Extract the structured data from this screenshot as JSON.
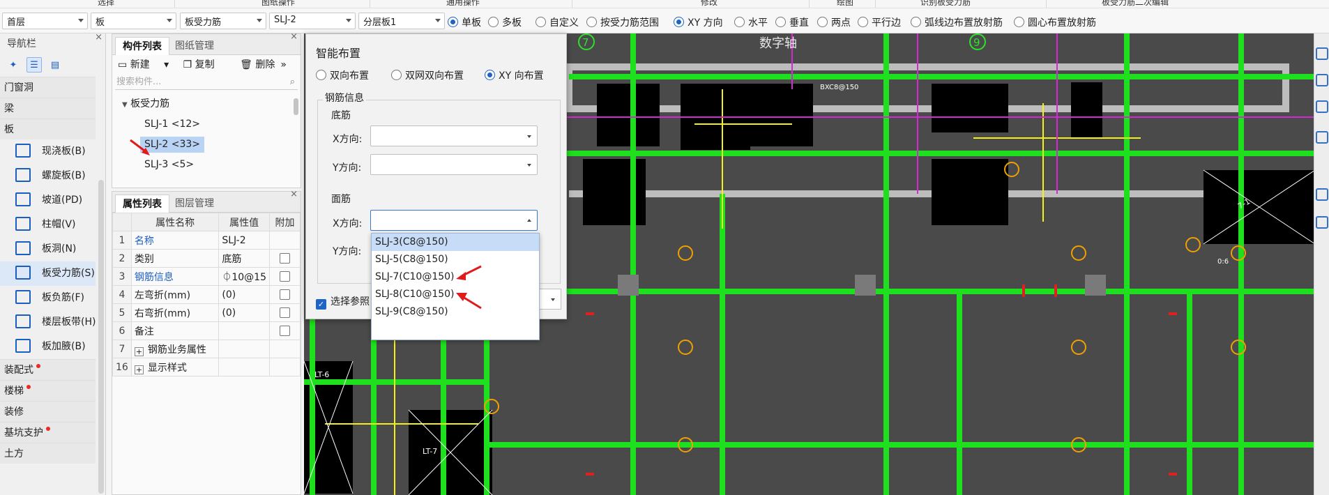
{
  "ribbon": {
    "groups": [
      "选择",
      "图纸操作",
      "通用操作",
      "修改",
      "绘图",
      "识别板受力筋",
      "板受力筋二次编辑"
    ]
  },
  "toolbar": {
    "floor": "首层",
    "category": "板",
    "component_type": "板受力筋",
    "component": "SLJ-2",
    "layer": "分层板1",
    "radios": [
      {
        "label": "单板",
        "checked": true
      },
      {
        "label": "多板",
        "checked": false
      },
      {
        "label": "自定义",
        "checked": false
      },
      {
        "label": "按受力筋范围",
        "checked": false
      },
      {
        "label": "XY 方向",
        "checked": true
      },
      {
        "label": "水平",
        "checked": false
      },
      {
        "label": "垂直",
        "checked": false
      },
      {
        "label": "两点",
        "checked": false
      },
      {
        "label": "平行边",
        "checked": false
      },
      {
        "label": "弧线边布置放射筋",
        "checked": false
      },
      {
        "label": "圆心布置放射筋",
        "checked": false
      }
    ]
  },
  "nav": {
    "title": "导航栏",
    "close": "×",
    "categories": {
      "door_window": "门窗洞",
      "beam": "梁",
      "slab": "板",
      "prefab": "装配式",
      "stairs": "楼梯",
      "decoration": "装修",
      "pit": "基坑支护",
      "earth": "土方"
    },
    "slab_items": [
      "现浇板(B)",
      "螺旋板(B)",
      "坡道(PD)",
      "柱帽(V)",
      "板洞(N)",
      "板受力筋(S)",
      "板负筋(F)",
      "楼层板带(H)",
      "板加腋(B)"
    ]
  },
  "component_panel": {
    "tab_list": "构件列表",
    "tab_drawing": "图纸管理",
    "close": "×",
    "new": "新建",
    "copy": "复制",
    "delete": "删除",
    "more": "»",
    "search_placeholder": "搜索构件...",
    "tree_root": "板受力筋",
    "items": [
      "SLJ-1 <12>",
      "SLJ-2 <33>",
      "SLJ-3 <5>"
    ]
  },
  "property_panel": {
    "tab_props": "属性列表",
    "tab_layers": "图层管理",
    "close": "×",
    "headers": [
      "属性名称",
      "属性值",
      "附加"
    ],
    "rows": [
      {
        "n": "1",
        "name": "名称",
        "value": "SLJ-2"
      },
      {
        "n": "2",
        "name": "类别",
        "value": "底筋"
      },
      {
        "n": "3",
        "name": "钢筋信息",
        "value": "⏀10@15"
      },
      {
        "n": "4",
        "name": "左弯折(mm)",
        "value": "(0)"
      },
      {
        "n": "5",
        "name": "右弯折(mm)",
        "value": "(0)"
      },
      {
        "n": "6",
        "name": "备注",
        "value": ""
      },
      {
        "n": "7",
        "name": "钢筋业务属性",
        "value": ""
      },
      {
        "n": "16",
        "name": "显示样式",
        "value": ""
      }
    ]
  },
  "dialog": {
    "title": "智能布置",
    "modes": [
      {
        "label": "双向布置",
        "checked": false
      },
      {
        "label": "双网双向布置",
        "checked": false
      },
      {
        "label": "XY 向布置",
        "checked": true
      }
    ],
    "group_label": "钢筋信息",
    "bottom_label": "底筋",
    "top_label": "面筋",
    "x_dir": "X方向:",
    "y_dir": "Y方向:",
    "select_ref": "选择参照"
  },
  "dropdown": {
    "options": [
      "SLJ-3(C8@150)",
      "SLJ-5(C8@150)",
      "SLJ-7(C10@150)",
      "SLJ-8(C10@150)",
      "SLJ-9(C8@150)"
    ],
    "selected_index": 0
  },
  "cad": {
    "axis_label": "数字轴",
    "axis_left": "7",
    "axis_right": "9",
    "labels": [
      "LT-6",
      "LT-7",
      "7-1"
    ],
    "rebar_notes": [
      "0:6",
      "BXC8@150"
    ]
  }
}
